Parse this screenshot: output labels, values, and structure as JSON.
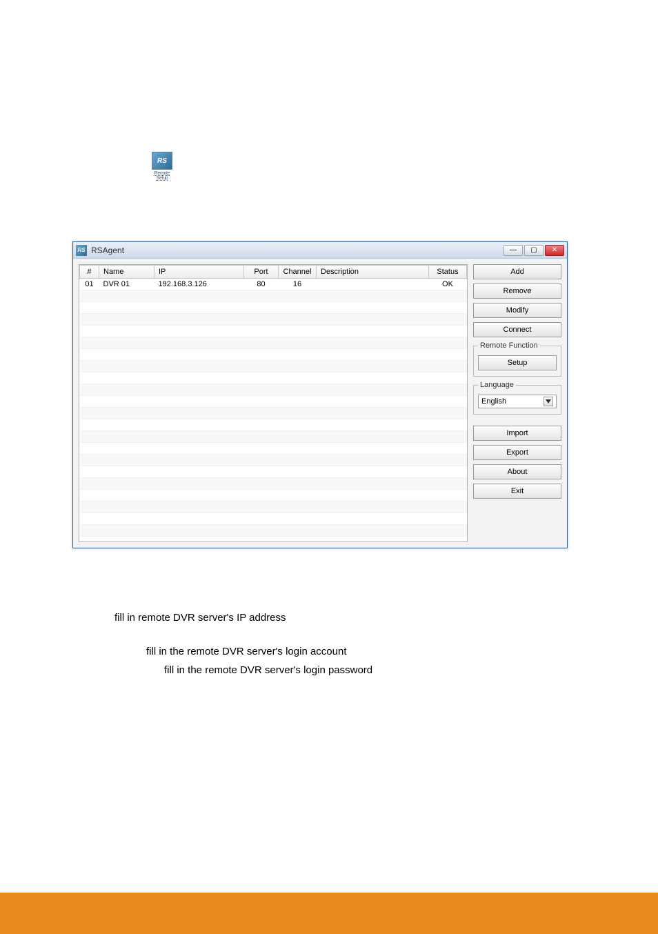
{
  "icon": {
    "label": "RS",
    "caption": "Remote Setup"
  },
  "window": {
    "title": "RSAgent",
    "columns": {
      "num": "#",
      "name": "Name",
      "ip": "IP",
      "port": "Port",
      "channel": "Channel",
      "description": "Description",
      "status": "Status"
    },
    "rows": [
      {
        "num": "01",
        "name": "DVR 01",
        "ip": "192.168.3.126",
        "port": "80",
        "channel": "16",
        "description": "",
        "status": "OK"
      }
    ],
    "buttons": {
      "add": "Add",
      "remove": "Remove",
      "modify": "Modify",
      "connect": "Connect",
      "setup": "Setup",
      "import": "Import",
      "export": "Export",
      "about": "About",
      "exit": "Exit"
    },
    "groups": {
      "remote_function": "Remote Function",
      "language": "Language"
    },
    "language_selected": "English",
    "winbtns": {
      "min": "—",
      "max": "▢",
      "close": "✕"
    }
  },
  "instructions": {
    "ip": "fill in remote DVR server's IP address",
    "account": "fill in the remote DVR server's login account",
    "password": "fill in the remote DVR server's login password"
  }
}
